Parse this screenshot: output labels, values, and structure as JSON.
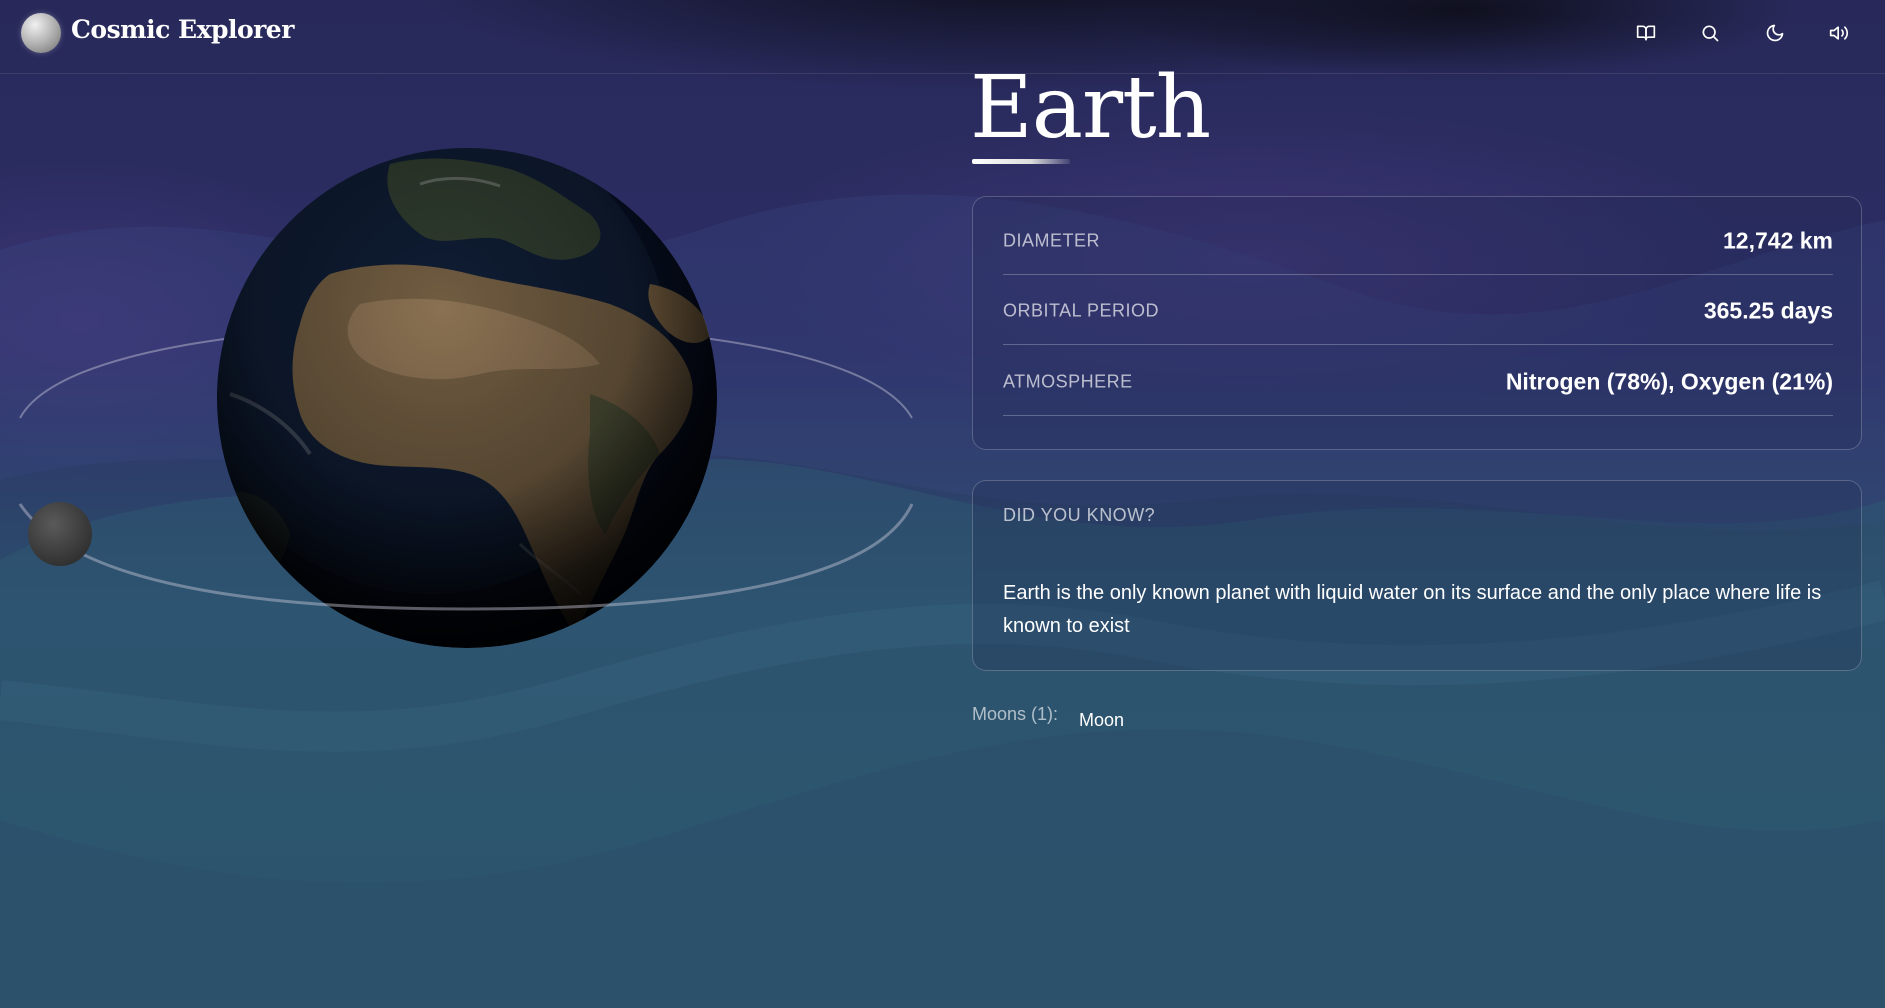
{
  "app": {
    "name": "Cosmic Explorer"
  },
  "header": {
    "actions": [
      {
        "icon": "book-open-icon"
      },
      {
        "icon": "search-icon"
      },
      {
        "icon": "moon-icon"
      },
      {
        "icon": "volume-icon"
      }
    ]
  },
  "planet": {
    "name": "Earth",
    "facts": [
      {
        "label": "DIAMETER",
        "value": "12,742 km"
      },
      {
        "label": "ORBITAL PERIOD",
        "value": "365.25 days"
      },
      {
        "label": "ATMOSPHERE",
        "value": "Nitrogen (78%), Oxygen (21%)"
      }
    ],
    "trivia": {
      "heading": "DID YOU KNOW?",
      "text": "Earth is the only known planet with liquid water on its surface and the only place where life is known to exist"
    },
    "moons": {
      "label": "Moons (1):",
      "items": [
        "Moon"
      ]
    }
  },
  "colors": {
    "background_top": "#2a2b5e",
    "background_bottom": "#2a5068",
    "accent": "#ffffff",
    "muted_text": "#b4b8c8"
  }
}
